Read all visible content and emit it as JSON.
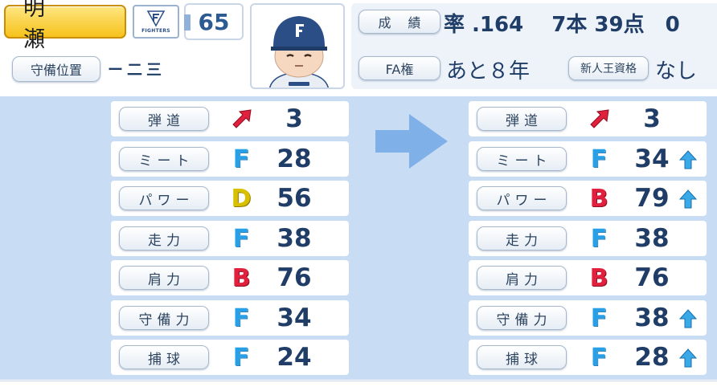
{
  "player": {
    "name": "明 瀬",
    "team_name": "FIGHTERS",
    "uniform_number": "65"
  },
  "position": {
    "label": "守備位置",
    "value": "ー二三"
  },
  "record": {
    "label": "成 績",
    "value": "率 .164　 7本 39点　0"
  },
  "fa": {
    "label": "FA権",
    "value": "あと８年"
  },
  "rookie": {
    "label": "新人王資格",
    "value": "なし"
  },
  "colors": {
    "rank_F": "#27a0e8",
    "rank_D": "#d8c000",
    "rank_B": "#e0203c",
    "trajectory": "#e0203c",
    "up_arrow": "#39a9e8",
    "panel_bg": "#c8dcf4"
  },
  "before": [
    {
      "label": "弾道",
      "rank": "",
      "icon": "trajectory-arrow-icon",
      "value": "3"
    },
    {
      "label": "ミート",
      "rank": "F",
      "value": "28"
    },
    {
      "label": "パワー",
      "rank": "D",
      "value": "56"
    },
    {
      "label": "走力",
      "rank": "F",
      "value": "38"
    },
    {
      "label": "肩力",
      "rank": "B",
      "value": "76"
    },
    {
      "label": "守備力",
      "rank": "F",
      "value": "34"
    },
    {
      "label": "捕球",
      "rank": "F",
      "value": "24"
    }
  ],
  "after": [
    {
      "label": "弾道",
      "rank": "",
      "icon": "trajectory-arrow-icon",
      "value": "3",
      "up": false
    },
    {
      "label": "ミート",
      "rank": "F",
      "value": "34",
      "up": true
    },
    {
      "label": "パワー",
      "rank": "B",
      "value": "79",
      "up": true
    },
    {
      "label": "走力",
      "rank": "F",
      "value": "38",
      "up": false
    },
    {
      "label": "肩力",
      "rank": "B",
      "value": "76",
      "up": false
    },
    {
      "label": "守備力",
      "rank": "F",
      "value": "38",
      "up": true
    },
    {
      "label": "捕球",
      "rank": "F",
      "value": "28",
      "up": true
    }
  ]
}
